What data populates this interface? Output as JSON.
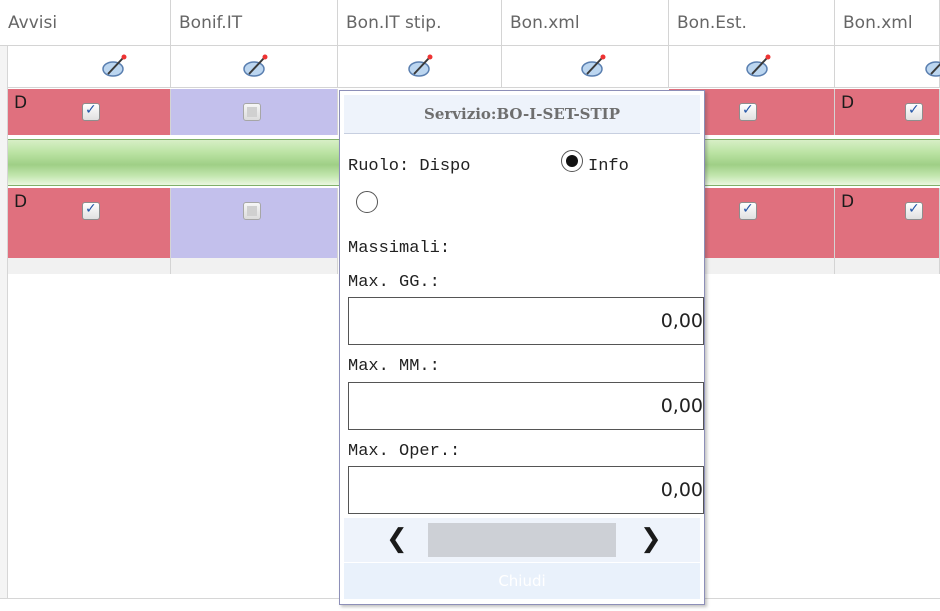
{
  "columns": [
    "Avvisi",
    "Bonif.IT",
    "Bon.IT stip.",
    "Bon.xml",
    "Bon.Est.",
    "Bon.xml"
  ],
  "row_letter": "D",
  "popup": {
    "title": "Servizio:BO-I-SET-STIP",
    "ruolo_label": "Ruolo: Dispo",
    "info_label": "Info",
    "massimali_label": "Massimali:",
    "max_gg_label": "Max. GG.:",
    "max_gg_value": "0,00",
    "max_mm_label": "Max. MM.:",
    "max_mm_value": "0,00",
    "max_oper_label": "Max. Oper.:",
    "max_oper_value": "0,00",
    "close_label": "Chiudi"
  },
  "colors": {
    "row_pink": "#e0707e",
    "row_lavender": "#c3c0ec",
    "group_bar": "#b9e2a1",
    "popup_header": "#eef3fb"
  }
}
